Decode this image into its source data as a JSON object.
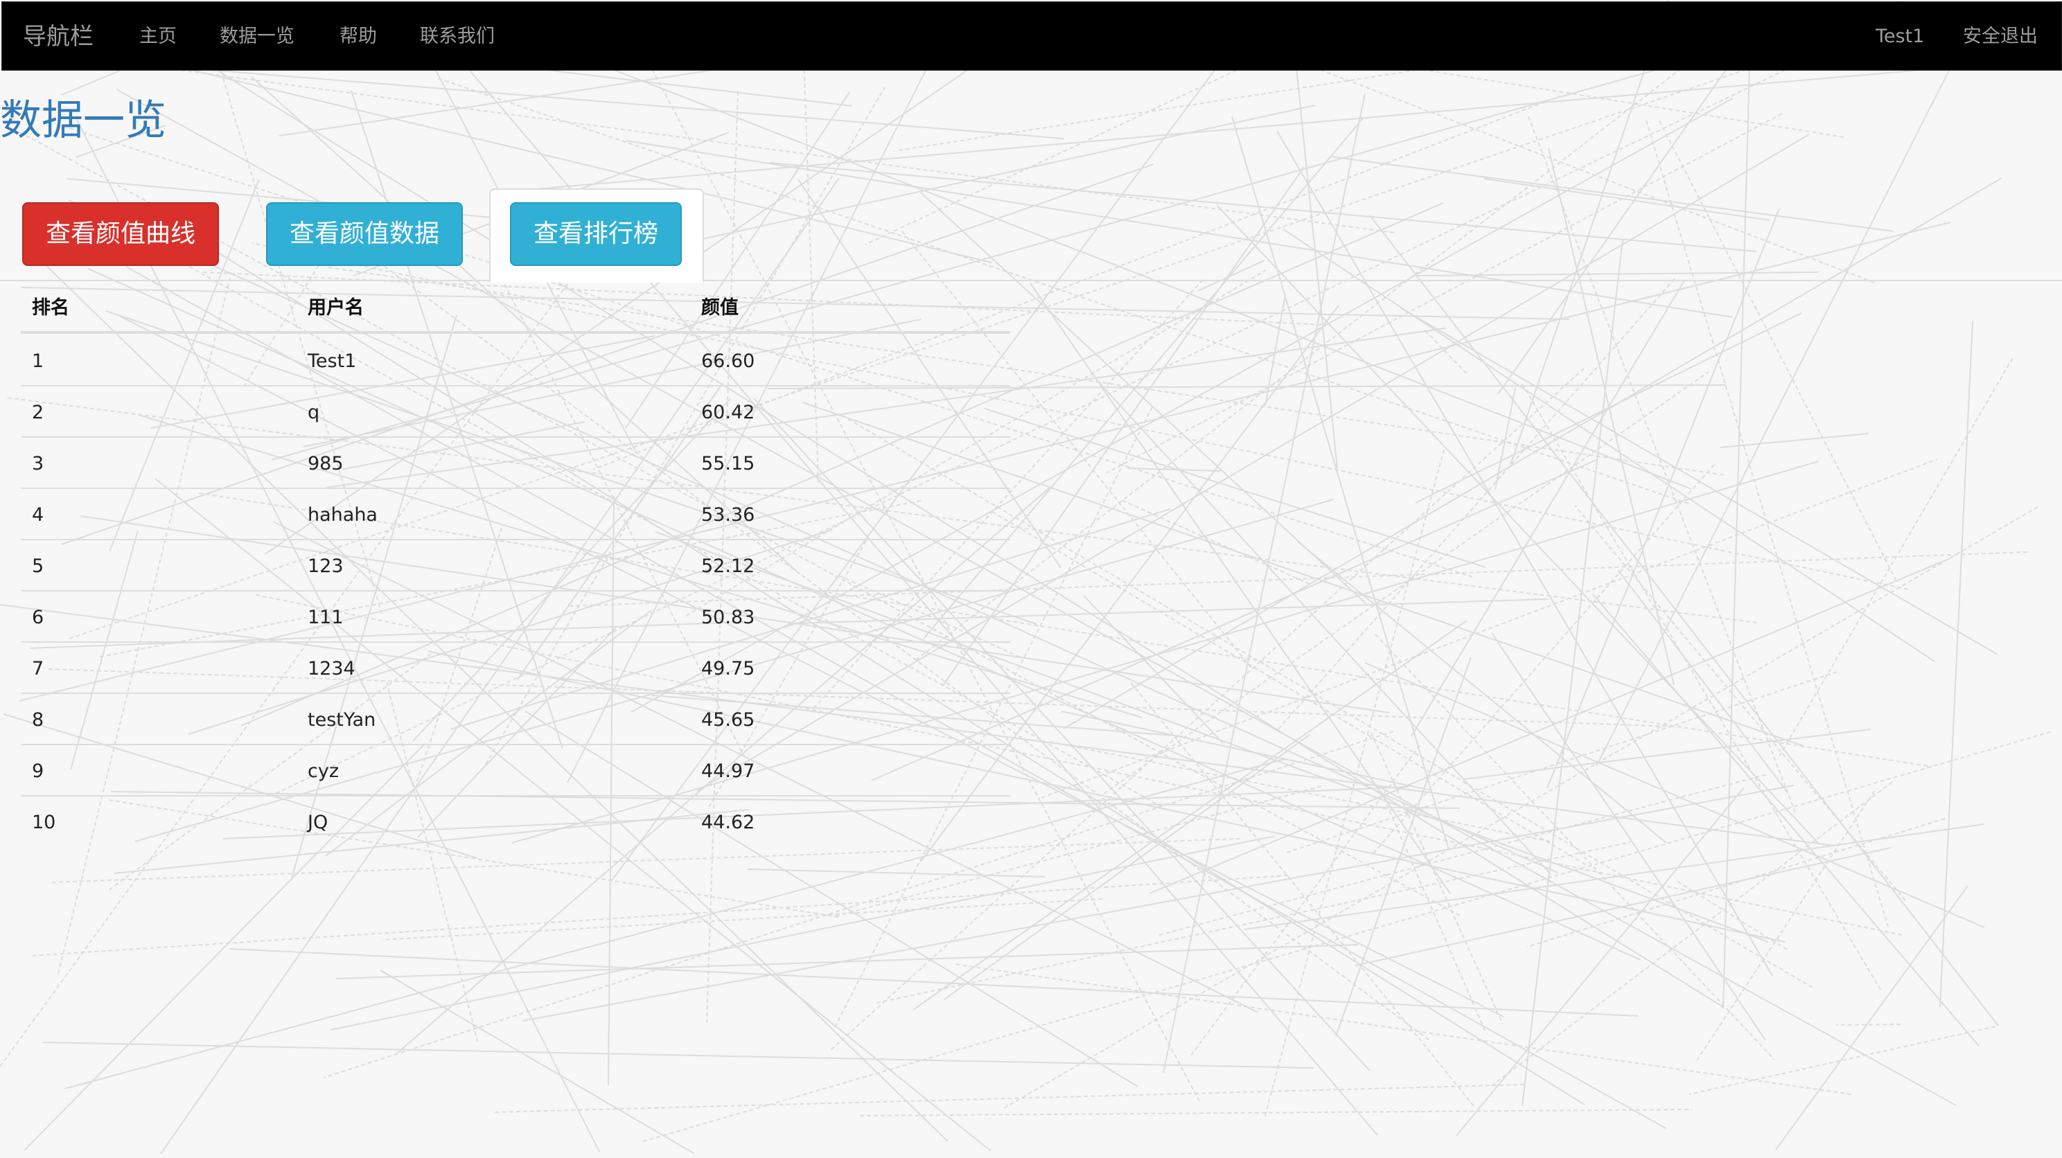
{
  "colors": {
    "navbar_bg": "#000000",
    "nav_text": "#9d9d9d",
    "title": "#337ab7",
    "btn_danger": "#d9302c",
    "btn_info": "#31b0d5",
    "background": "#f7f7f7"
  },
  "navbar": {
    "brand": "导航栏",
    "links": [
      "主页",
      "数据一览",
      "帮助",
      "联系我们"
    ],
    "user": "Test1",
    "logout": "安全退出"
  },
  "page": {
    "title": "数据一览"
  },
  "tabs": [
    {
      "label": "查看颜值曲线",
      "style": "danger"
    },
    {
      "label": "查看颜值数据",
      "style": "info"
    },
    {
      "label": "查看排行榜",
      "style": "info",
      "active": true
    }
  ],
  "ranking_table": {
    "headers": [
      "排名",
      "用户名",
      "颜值"
    ],
    "rows": [
      [
        "1",
        "Test1",
        "66.60"
      ],
      [
        "2",
        "q",
        "60.42"
      ],
      [
        "3",
        "985",
        "55.15"
      ],
      [
        "4",
        "hahaha",
        "53.36"
      ],
      [
        "5",
        "123",
        "52.12"
      ],
      [
        "6",
        "111",
        "50.83"
      ],
      [
        "7",
        "1234",
        "49.75"
      ],
      [
        "8",
        "testYan",
        "45.65"
      ],
      [
        "9",
        "cyz",
        "44.97"
      ],
      [
        "10",
        "JQ",
        "44.62"
      ]
    ]
  }
}
